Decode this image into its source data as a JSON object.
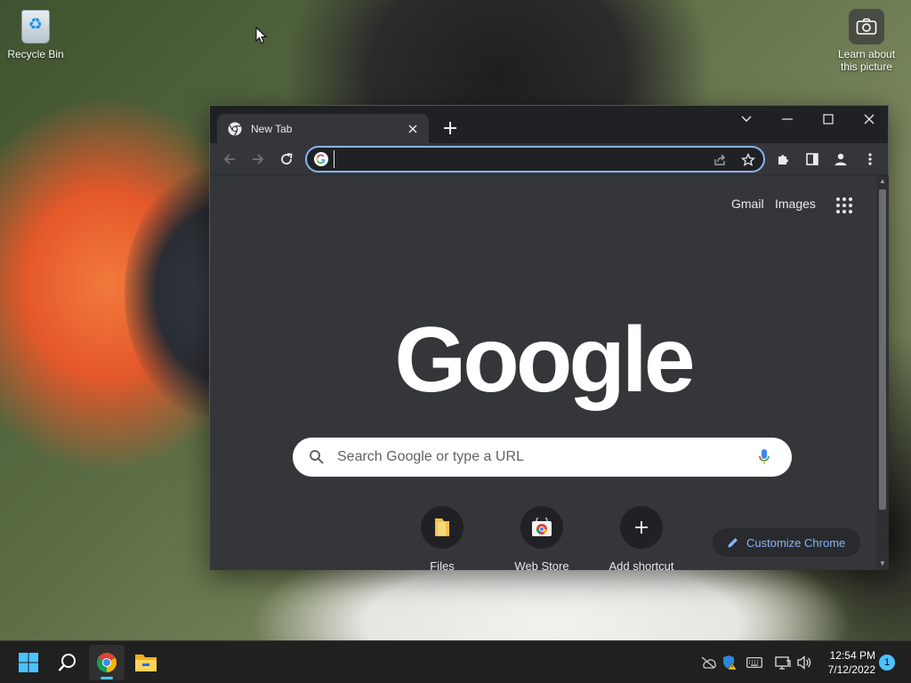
{
  "desktop": {
    "icons": [
      {
        "label": "Recycle Bin",
        "icon": "recycle-bin-icon"
      },
      {
        "label": "Learn about this picture",
        "icon": "camera-icon"
      }
    ]
  },
  "browser": {
    "tab": {
      "title": "New Tab",
      "favicon": "chrome-icon"
    },
    "window_controls": [
      "tab-search",
      "minimize",
      "maximize",
      "close"
    ],
    "toolbar": {
      "back": "back-arrow-icon",
      "forward": "forward-arrow-icon",
      "reload": "reload-icon",
      "omnibox_value": "",
      "omnibox_icons": [
        "share-icon",
        "star-icon"
      ],
      "right_icons": [
        "extensions-icon",
        "side-panel-icon",
        "profile-icon",
        "menu-icon"
      ]
    },
    "page": {
      "top_links": {
        "gmail": "Gmail",
        "images": "Images"
      },
      "logo": "Google",
      "search_placeholder": "Search Google or type a URL",
      "shortcuts": [
        {
          "label": "Files",
          "icon": "folder-icon"
        },
        {
          "label": "Web Store",
          "icon": "web-store-icon"
        },
        {
          "label": "Add shortcut",
          "icon": "plus-icon"
        }
      ],
      "customize_label": "Customize Chrome"
    }
  },
  "taskbar": {
    "apps": [
      "start-icon",
      "search-icon",
      "chrome-icon",
      "file-explorer-icon"
    ],
    "tray": [
      "network-off-icon",
      "security-warning-icon",
      "keyboard-icon",
      "display-icon",
      "volume-icon"
    ],
    "time": "12:54 PM",
    "date": "7/12/2022",
    "notification_count": "1"
  },
  "colors": {
    "accent": "#8ab4f8",
    "window_bg": "#35363a",
    "titlebar_bg": "#202124",
    "taskbar_bg": "#202020"
  }
}
